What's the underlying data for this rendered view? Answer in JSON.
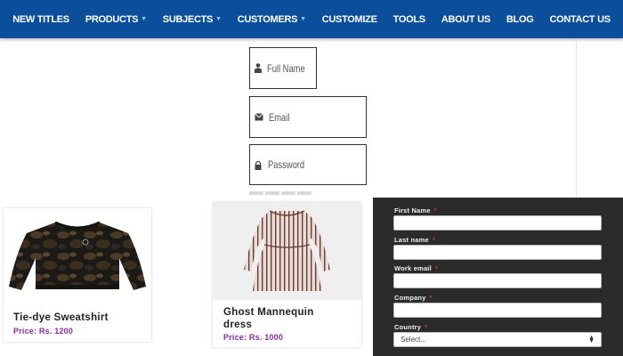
{
  "nav": {
    "items": [
      {
        "label": "NEW TITLES",
        "dropdown": false
      },
      {
        "label": "PRODUCTS",
        "dropdown": true
      },
      {
        "label": "SUBJECTS",
        "dropdown": true
      },
      {
        "label": "CUSTOMERS",
        "dropdown": true
      },
      {
        "label": "CUSTOMIZE",
        "dropdown": false
      },
      {
        "label": "TOOLS",
        "dropdown": false
      },
      {
        "label": "ABOUT US",
        "dropdown": false
      },
      {
        "label": "BLOG",
        "dropdown": false
      },
      {
        "label": "CONTACT US",
        "dropdown": false
      }
    ],
    "background": "#0b4f9c"
  },
  "signup": {
    "full_name_placeholder": "Full Name",
    "email_placeholder": "Email",
    "password_placeholder": "Password"
  },
  "products": [
    {
      "name": "Tie-dye Sweatshirt",
      "price": "Price: Rs. 1200"
    },
    {
      "name": "Ghost Mannequin dress",
      "price": "Price: Rs. 1000"
    }
  ],
  "form": {
    "first_name_label": "First Name",
    "last_name_label": "Last name",
    "work_email_label": "Work email",
    "company_label": "Company",
    "country_label": "Country",
    "required_mark": "*",
    "country_select_value": "Select...",
    "background": "#2b2b2b"
  },
  "colors": {
    "price": "#8e2aa8",
    "required": "#dd3333"
  }
}
